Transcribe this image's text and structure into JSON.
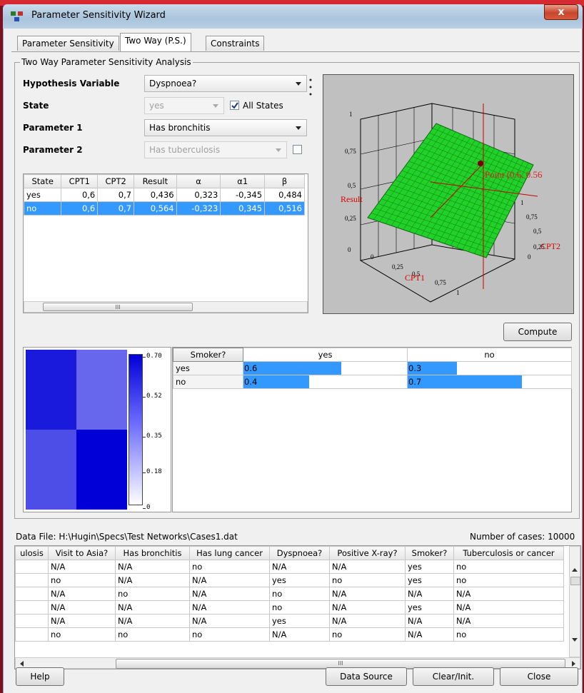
{
  "window": {
    "title": "Parameter Sensitivity Wizard",
    "close_label": "x"
  },
  "tabs": [
    "Parameter Sensitivity",
    "Two Way (P.S.)",
    "Constraints"
  ],
  "group_title": "Two Way Parameter Sensitivity Analysis",
  "form": {
    "hypothesis_label": "Hypothesis Variable",
    "hypothesis_value": "Dyspnoea?",
    "state_label": "State",
    "state_value": "yes",
    "all_states_label": "All States",
    "param1_label": "Parameter 1",
    "param1_value": "Has bronchitis",
    "param2_label": "Parameter 2",
    "param2_value": "Has tuberculosis"
  },
  "results": {
    "headers": [
      "State",
      "CPT1",
      "CPT2",
      "Result",
      "α",
      "α1",
      "β"
    ],
    "rows": [
      [
        "yes",
        "0,6",
        "0,7",
        "0,436",
        "0,323",
        "-0,345",
        "0,484"
      ],
      [
        "no",
        "0,6",
        "0,7",
        "0,564",
        "-0,323",
        "0,345",
        "0,516"
      ]
    ],
    "scroll_glyph": "III"
  },
  "plot": {
    "z_label": "Result",
    "x_label": "CPT1",
    "y_label": "CPT2",
    "point_label": "Point (0.6, 0.56",
    "z_ticks": [
      "1",
      "0,75",
      "0,5",
      "0,25",
      "0"
    ],
    "x_ticks": [
      "0",
      "0,25",
      "0,5",
      "0,75",
      "1"
    ],
    "y_ticks": [
      "1",
      "0,75",
      "0,5",
      "0,25",
      "0"
    ]
  },
  "compute_label": "Compute",
  "heatmap": {
    "legend_ticks": [
      "0.70",
      "0.52",
      "0.35",
      "0.18",
      "0"
    ],
    "cells": [
      0.6,
      0.3,
      0.4,
      0.7
    ]
  },
  "cpt": {
    "corner": "Smoker?",
    "col_headers": [
      "yes",
      "no"
    ],
    "rows": [
      {
        "label": "yes",
        "values": [
          "0.6",
          "0.3"
        ]
      },
      {
        "label": "no",
        "values": [
          "0.4",
          "0.7"
        ]
      }
    ],
    "fills": [
      0.6,
      0.3,
      0.4,
      0.7
    ]
  },
  "data": {
    "file_label": "Data File: H:\\Hugin\\Specs\\Test Networks\\Cases1.dat",
    "cases_label": "Number of cases: 10000",
    "headers": [
      "ulosis",
      "Visit to Asia?",
      "Has bronchitis",
      "Has lung cancer",
      "Dyspnoea?",
      "Positive X-ray?",
      "Smoker?",
      "Tuberculosis or cancer"
    ],
    "rows": [
      [
        "",
        "N/A",
        "N/A",
        "no",
        "N/A",
        "N/A",
        "yes",
        "no"
      ],
      [
        "",
        "no",
        "N/A",
        "N/A",
        "yes",
        "no",
        "yes",
        "no"
      ],
      [
        "",
        "N/A",
        "no",
        "N/A",
        "no",
        "N/A",
        "N/A",
        "N/A"
      ],
      [
        "",
        "N/A",
        "N/A",
        "N/A",
        "no",
        "N/A",
        "yes",
        "N/A"
      ],
      [
        "",
        "N/A",
        "N/A",
        "N/A",
        "yes",
        "N/A",
        "N/A",
        "N/A"
      ],
      [
        "",
        "no",
        "no",
        "no",
        "N/A",
        "no",
        "N/A",
        "no"
      ]
    ],
    "scroll_glyph": "III"
  },
  "buttons": {
    "help": "Help",
    "data_source": "Data Source",
    "clear": "Clear/Init.",
    "close": "Close"
  }
}
